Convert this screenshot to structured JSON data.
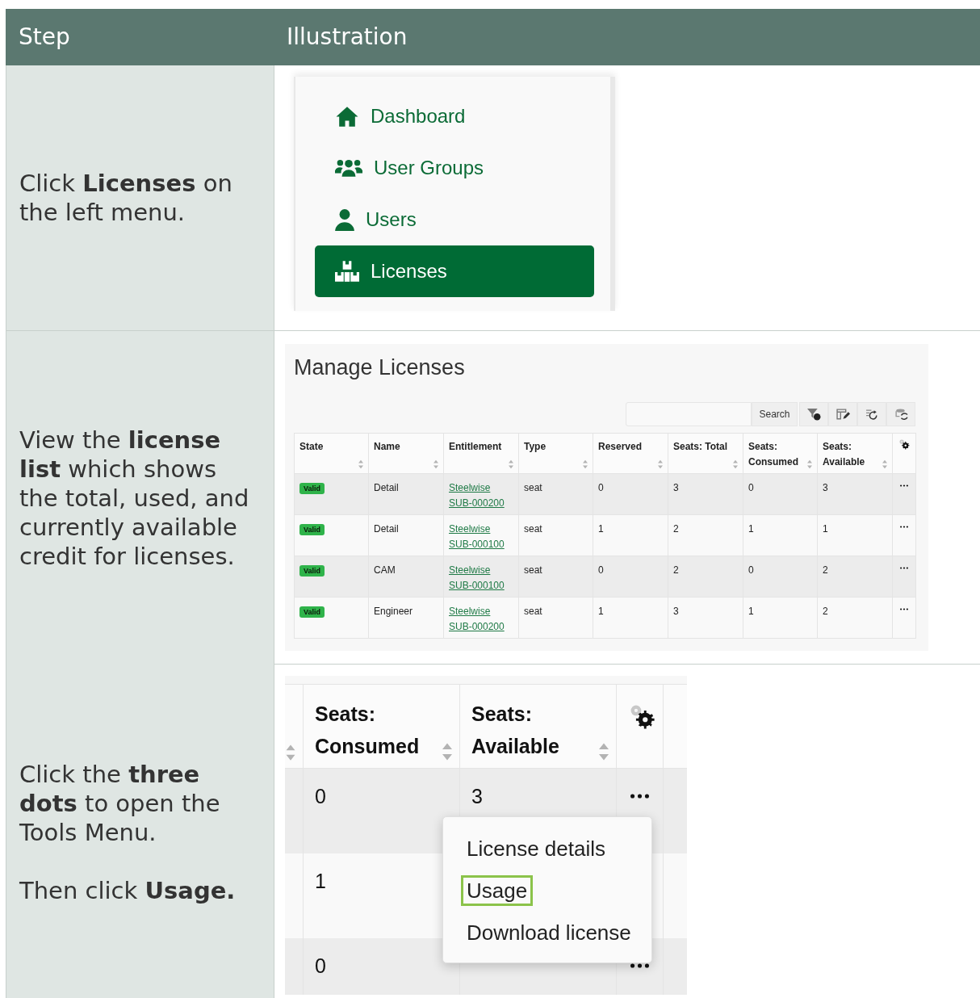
{
  "header": {
    "step": "Step",
    "illustration": "Illustration"
  },
  "steps": [
    {
      "instruction": [
        "Click **Licenses** on the left menu."
      ],
      "illustration": {
        "kind": "menu",
        "items": [
          {
            "label": "Dashboard",
            "selected": false
          },
          {
            "label": "User Groups",
            "selected": false
          },
          {
            "label": "Users",
            "selected": false
          },
          {
            "label": "Licenses",
            "selected": true
          }
        ]
      }
    },
    {
      "instruction": [
        "View the **license list** which shows the total, used, and currently available credit for licenses."
      ],
      "illustration": {
        "kind": "license_table",
        "title": "Manage Licenses",
        "search_button": "Search",
        "columns": [
          "State",
          "Name",
          "Entitlement",
          "Type",
          "Reserved",
          "Seats: Total",
          "Seats: Consumed",
          "Seats: Available"
        ],
        "rows": [
          {
            "state": "Valid",
            "name": "Detail",
            "entitlement": [
              "Steelwise",
              "SUB-000200"
            ],
            "type": "seat",
            "reserved": "0",
            "total": "3",
            "consumed": "0",
            "available": "3"
          },
          {
            "state": "Valid",
            "name": "Detail",
            "entitlement": [
              "Steelwise",
              "SUB-000100"
            ],
            "type": "seat",
            "reserved": "1",
            "total": "2",
            "consumed": "1",
            "available": "1"
          },
          {
            "state": "Valid",
            "name": "CAM",
            "entitlement": [
              "Steelwise",
              "SUB-000100"
            ],
            "type": "seat",
            "reserved": "0",
            "total": "2",
            "consumed": "0",
            "available": "2"
          },
          {
            "state": "Valid",
            "name": "Engineer",
            "entitlement": [
              "Steelwise",
              "SUB-000200"
            ],
            "type": "seat",
            "reserved": "1",
            "total": "3",
            "consumed": "1",
            "available": "2"
          }
        ]
      }
    },
    {
      "instruction": [
        "Click the **three dots** to open the Tools Menu.",
        "Then click **Usage.**"
      ],
      "illustration": {
        "kind": "tools_menu",
        "columns": [
          "Seats: Consumed",
          "Seats: Available"
        ],
        "rows": [
          {
            "consumed": "0",
            "available": "3",
            "more": true
          },
          {
            "consumed": "1"
          },
          {
            "consumed": "0",
            "more": true
          }
        ],
        "menu": [
          {
            "label": "License details",
            "highlighted": false
          },
          {
            "label": "Usage",
            "highlighted": true
          },
          {
            "label": "Download license",
            "highlighted": false
          }
        ]
      }
    }
  ]
}
